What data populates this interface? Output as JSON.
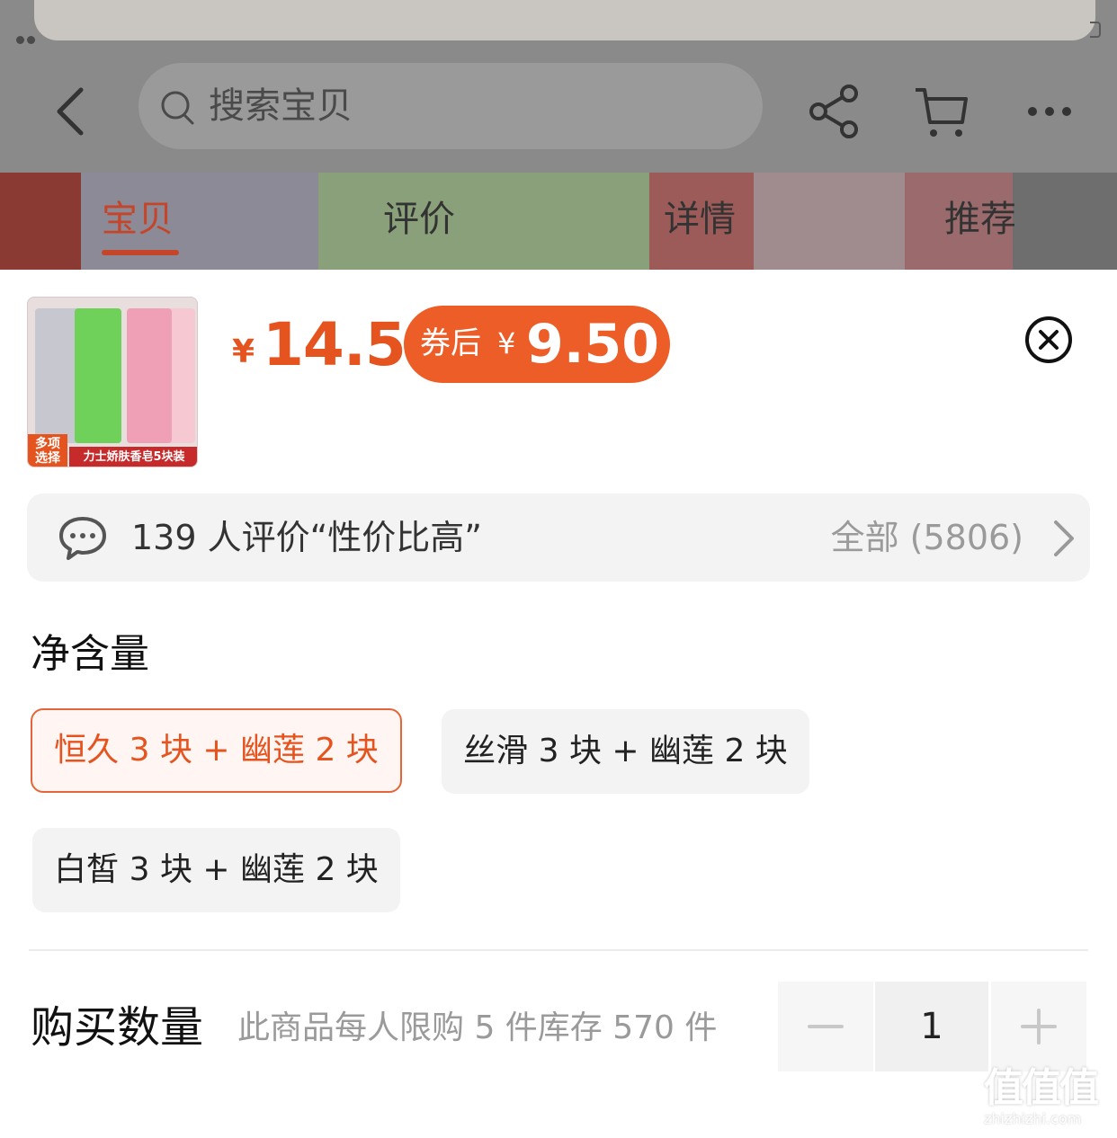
{
  "header": {
    "search_placeholder": "搜索宝贝",
    "icons": [
      "back-icon",
      "search-icon",
      "share-icon",
      "cart-icon",
      "more-icon"
    ]
  },
  "tabs": [
    {
      "label": "宝贝",
      "active": true
    },
    {
      "label": "评价",
      "active": false
    },
    {
      "label": "详情",
      "active": false
    },
    {
      "label": "推荐",
      "active": false
    }
  ],
  "product": {
    "thumb_tag_left": "多项选择",
    "thumb_tag_right": "力士娇肤香皂5块装",
    "currency": "¥",
    "price": "14.5",
    "coupon_label": "券后",
    "coupon_currency": "¥",
    "coupon_price": "9.50"
  },
  "reviews": {
    "summary": "139 人评价“性价比高”",
    "all_label": "全部 (5806)"
  },
  "spec": {
    "title": "净含量",
    "options": [
      {
        "label": "恒久 3 块 + 幽莲 2 块",
        "selected": true
      },
      {
        "label": "丝滑 3 块 + 幽莲 2 块",
        "selected": false
      },
      {
        "label": "白皙 3 块 + 幽莲 2 块",
        "selected": false
      }
    ]
  },
  "quantity": {
    "label": "购买数量",
    "note": "此商品每人限购 5 件库存 570 件",
    "value": "1",
    "minus_label": "—",
    "plus_label": "+"
  },
  "watermark": {
    "mark": "值值值",
    "url": "zhizhizhi.com"
  },
  "colors": {
    "accent": "#e5531f",
    "coupon_bg": "#ec5d28",
    "tab_active": "#c4452a"
  }
}
